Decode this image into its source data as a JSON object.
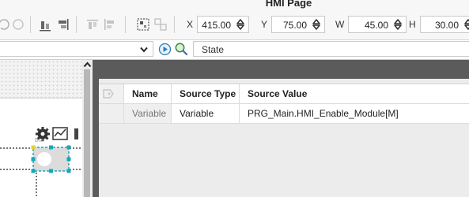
{
  "app": {
    "title": "HMI Page"
  },
  "toolbar": {
    "x_label": "X",
    "x_value": "415.00",
    "y_label": "Y",
    "y_value": "75.00",
    "w_label": "W",
    "w_value": "45.00",
    "h_label": "H",
    "h_value": "30.00",
    "icons": [
      "align-bottom-icon",
      "align-right-icon",
      "bring-front-icon",
      "send-back-icon",
      "group-icon",
      "ungroup-icon",
      "spinner-up-down-icon"
    ]
  },
  "subbar": {
    "dropdown_value": "",
    "state_field_value": "State",
    "icons": [
      "chevron-down-icon",
      "play-circle-icon",
      "search-zoom-icon"
    ]
  },
  "canvas": {
    "widget_icons": [
      "gear-icon",
      "trend-chart-icon"
    ]
  },
  "grid": {
    "columns": [
      "Name",
      "Source Type",
      "Source Value"
    ],
    "rows": [
      {
        "name": "Variable",
        "source_type": "Variable",
        "source_value": "PRG_Main.HMI_Enable_Module[M]"
      }
    ]
  },
  "colors": {
    "panel_dark": "#5b5b5b",
    "selection_handle": "#1aa6b7",
    "accent_yellow": "#e3d23a"
  }
}
